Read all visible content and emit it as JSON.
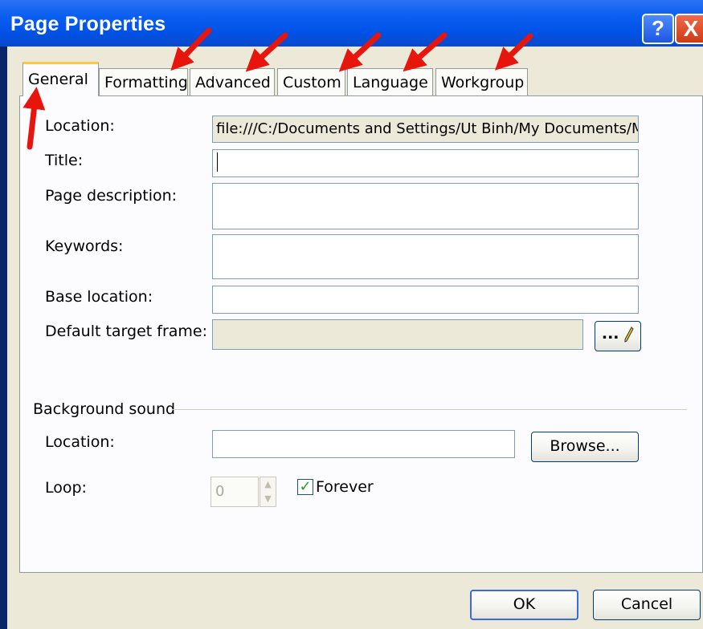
{
  "window": {
    "title": "Page Properties",
    "help_label": "?",
    "close_label": "X"
  },
  "tabs": [
    {
      "label": "General",
      "active": true
    },
    {
      "label": "Formatting"
    },
    {
      "label": "Advanced"
    },
    {
      "label": "Custom"
    },
    {
      "label": "Language"
    },
    {
      "label": "Workgroup"
    }
  ],
  "general": {
    "location_label": "Location:",
    "location_value": "file:///C:/Documents and Settings/Ut Binh/My Documents/M",
    "title_label": "Title:",
    "title_value": "",
    "page_description_label": "Page description:",
    "page_description_value": "",
    "keywords_label": "Keywords:",
    "keywords_value": "",
    "base_location_label": "Base location:",
    "base_location_value": "",
    "default_target_frame_label": "Default target frame:",
    "default_target_frame_value": "",
    "target_frame_button_label": "..."
  },
  "background_sound": {
    "group_label": "Background sound",
    "location_label": "Location:",
    "location_value": "",
    "browse_label": "Browse...",
    "loop_label": "Loop:",
    "loop_value": "0",
    "forever_label": "Forever",
    "forever_checked": true
  },
  "footer": {
    "ok_label": "OK",
    "cancel_label": "Cancel"
  },
  "colors": {
    "annotation_arrow": "#e8150d",
    "tab_highlight": "#ffc83c",
    "title_bar": "#0052e6"
  },
  "icons": {
    "target_frame_button": "pencil-icon",
    "spin_up": "spin-up-icon",
    "spin_down": "spin-down-icon",
    "checkmark": "checkmark-icon"
  }
}
